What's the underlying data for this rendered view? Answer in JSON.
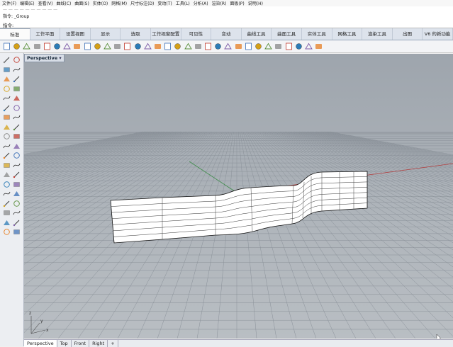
{
  "menu": [
    "文件(F)",
    "编辑(E)",
    "查看(V)",
    "曲线(C)",
    "曲面(S)",
    "实体(O)",
    "网格(M)",
    "尺寸标注(D)",
    "变动(T)",
    "工具(L)",
    "分析(A)",
    "渲染(R)",
    "面板(P)",
    "说明(H)"
  ],
  "history": {
    "line1": "指令: _Group"
  },
  "prompt": {
    "label": "指令:"
  },
  "tabs": [
    {
      "label": "标准",
      "active": true
    },
    {
      "label": "工作平面"
    },
    {
      "label": "设置视图"
    },
    {
      "label": "显示"
    },
    {
      "label": "选取"
    },
    {
      "label": "工作视窗配置"
    },
    {
      "label": "可见性"
    },
    {
      "label": "变动"
    },
    {
      "label": "曲线工具"
    },
    {
      "label": "曲面工具"
    },
    {
      "label": "实体工具"
    },
    {
      "label": "网格工具"
    },
    {
      "label": "渲染工具"
    },
    {
      "label": "出图"
    },
    {
      "label": "V6 的新功能"
    }
  ],
  "toolbar_icons": [
    "new-file-icon",
    "open-icon",
    "save-icon",
    "print-icon",
    "import-icon",
    "cut-icon",
    "copy-icon",
    "paste-icon",
    "undo-icon",
    "pan-icon",
    "move-view-icon",
    "zoom-icon",
    "zoom-window-icon",
    "zoom-extents-icon",
    "zoom-selected-icon",
    "rotate-view-icon",
    "four-viewports-icon",
    "grid-icon",
    "car-icon",
    "cplane-icon",
    "object-snap-icon",
    "select-icon",
    "properties-icon",
    "lightbulb-icon",
    "layer-icon",
    "paint-icon",
    "shade-icon",
    "render-icon",
    "material-icon",
    "sphere-icon",
    "options-icon",
    "help-icon"
  ],
  "viewport": {
    "title": "Perspective",
    "dropdown": "▾",
    "axes": {
      "x": "x",
      "y": "y",
      "z": "z"
    }
  },
  "viewport_tabs": [
    {
      "label": "Perspective",
      "active": true
    },
    {
      "label": "Top"
    },
    {
      "label": "Front"
    },
    {
      "label": "Right"
    },
    {
      "label": "+"
    }
  ],
  "colors": {
    "x_axis": "#b23a3a",
    "y_axis": "#3e8c4a",
    "grid": "#8f969e",
    "surface": "#ffffff"
  }
}
